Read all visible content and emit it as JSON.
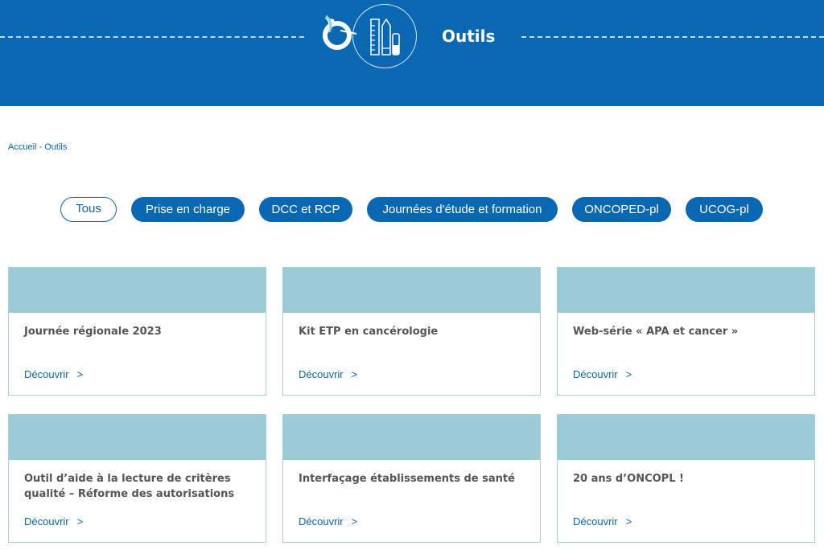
{
  "header": {
    "title": "Outils",
    "accent_color": "#0a67b2",
    "logo_icon": "ribbon-logo-icon",
    "section_icon": "ruler-pencil-tools-icon"
  },
  "breadcrumb": {
    "home": "Accueil",
    "separator": " - ",
    "current": "Outils"
  },
  "filters": [
    {
      "label": "Tous",
      "active": true
    },
    {
      "label": "Prise en charge",
      "active": false
    },
    {
      "label": "DCC et RCP",
      "active": false
    },
    {
      "label": "Journées d'étude et formation",
      "active": false
    },
    {
      "label": "ONCOPED-pl",
      "active": false
    },
    {
      "label": "UCOG-pl",
      "active": false
    }
  ],
  "cards": [
    {
      "title": "Journée régionale 2023",
      "link": "Découvrir",
      "chevron": ">"
    },
    {
      "title": "Kit ETP en cancérologie",
      "link": "Découvrir",
      "chevron": ">"
    },
    {
      "title": "Web-série « APA et cancer »",
      "link": "Découvrir",
      "chevron": ">"
    },
    {
      "title": "Outil d’aide à la lecture de critères qualité – Réforme des autorisations",
      "link": "Découvrir",
      "chevron": ">"
    },
    {
      "title": "Interfaçage établissements de santé",
      "link": "Découvrir",
      "chevron": ">"
    },
    {
      "title": "20 ans d’ONCOPL !",
      "link": "Découvrir",
      "chevron": ">"
    }
  ]
}
